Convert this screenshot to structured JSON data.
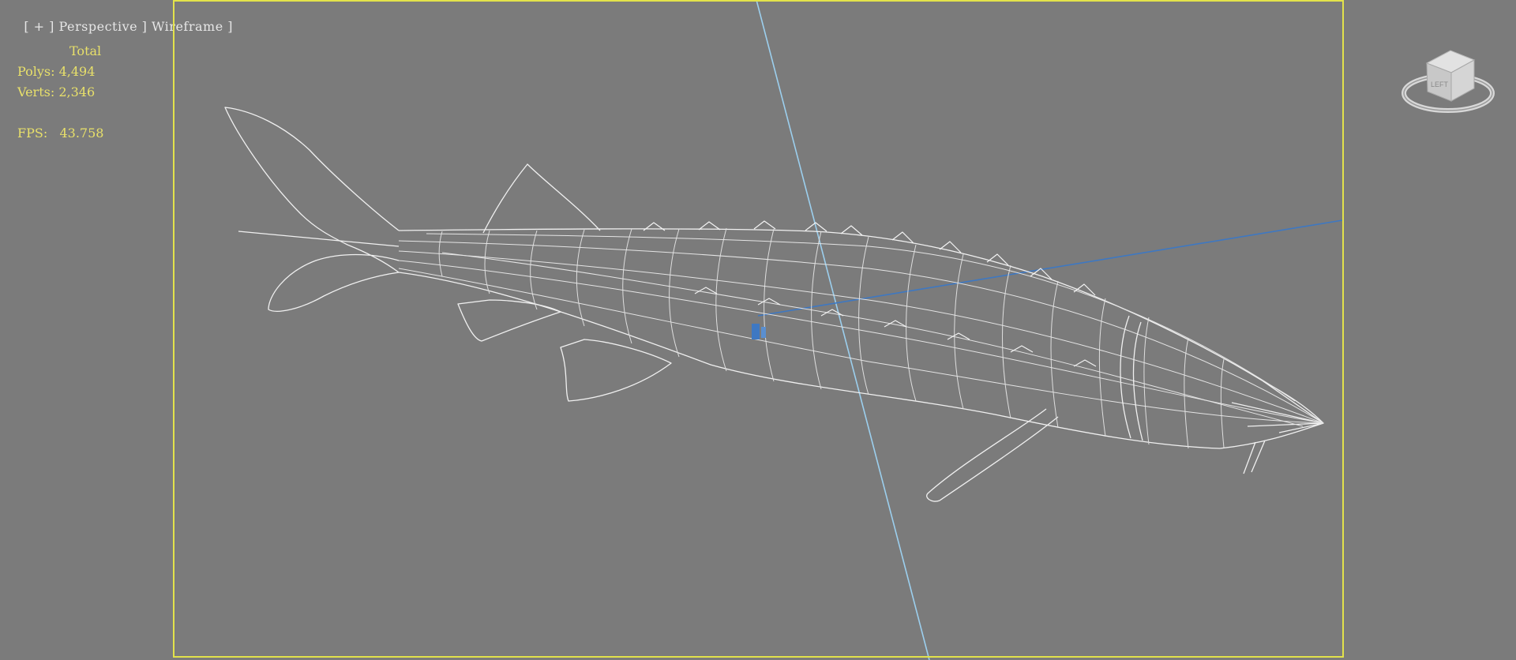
{
  "viewport": {
    "label_parts": [
      "[ ",
      "+",
      " ] ",
      "Perspective",
      " ] ",
      "Wireframe",
      " ]"
    ],
    "label_text": "[ + ] Perspective ] Wireframe ]",
    "menu_plus": "+",
    "view_name": "Perspective",
    "shading_mode": "Wireframe"
  },
  "stats": {
    "total_label": "Total",
    "polys_label": "Polys:",
    "polys_value": "4,494",
    "verts_label": "Verts:",
    "verts_value": "2,346",
    "fps_label": "FPS:",
    "fps_value": "43.758"
  },
  "viewcube": {
    "face_label": "LEFT",
    "icon": "viewcube-icon"
  },
  "colors": {
    "background": "#7b7b7b",
    "safe_frame": "#e2e24b",
    "stats_text": "#e8e06a",
    "wireframe": "#f2f2f2",
    "axis_light": "#9ccfee",
    "axis_dark": "#3e78c2"
  }
}
